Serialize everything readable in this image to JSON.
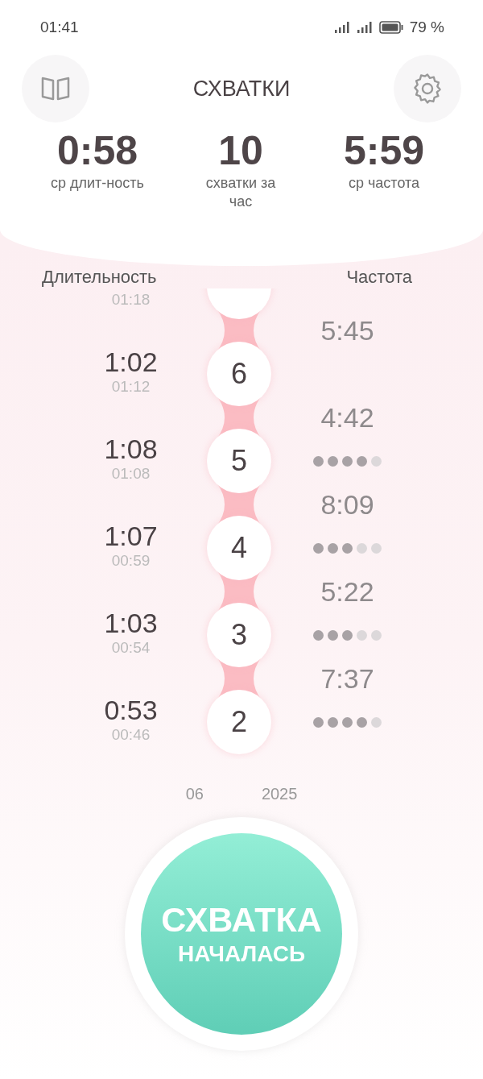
{
  "status_bar": {
    "time": "01:41",
    "battery_text": "79 %"
  },
  "header": {
    "title": "СХВАТКИ"
  },
  "stats": [
    {
      "value": "0:58",
      "label": "ср длит-ность"
    },
    {
      "value": "10",
      "label": "схватки за час"
    },
    {
      "value": "5:59",
      "label": "ср частота"
    }
  ],
  "columns": {
    "duration": "Длительность",
    "frequency": "Частота"
  },
  "contractions": [
    {
      "start": "01:18"
    },
    {
      "number": "6",
      "duration": "1:02",
      "start": "01:12",
      "frequency": "5:45"
    },
    {
      "number": "5",
      "duration": "1:08",
      "start": "01:08",
      "frequency": "4:42",
      "stars": 4
    },
    {
      "number": "4",
      "duration": "1:07",
      "start": "00:59",
      "frequency": "8:09",
      "stars": 3
    },
    {
      "number": "3",
      "duration": "1:03",
      "start": "00:54",
      "frequency": "5:22",
      "stars": 3
    },
    {
      "number": "2",
      "duration": "0:53",
      "start": "00:46",
      "frequency": "7:37",
      "stars": 4
    }
  ],
  "date_parts": [
    "06",
    "2025"
  ],
  "start_button": {
    "line1": "СХВАТКА",
    "line2": "НАЧАЛАСЬ"
  }
}
